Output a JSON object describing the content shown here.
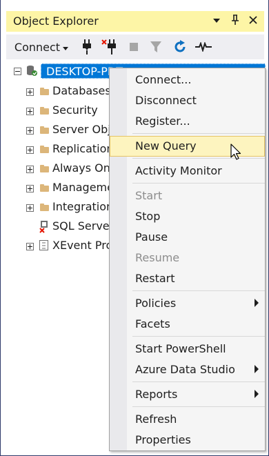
{
  "window": {
    "title": "Object Explorer"
  },
  "title_icons": [
    "chevron-down-icon",
    "pin-icon",
    "close-icon"
  ],
  "toolbar": {
    "connect_label": "Connect"
  },
  "tree": {
    "server_label": "DESKTOP-PDT",
    "nodes": [
      "Databases",
      "Security",
      "Server Obj",
      "Replication",
      "Always On",
      "Manageme",
      "Integration",
      "SQL Server",
      "XEvent Pro"
    ]
  },
  "context_menu": {
    "items": [
      {
        "label": "Connect...",
        "enabled": true
      },
      {
        "label": "Disconnect",
        "enabled": true
      },
      {
        "label": "Register...",
        "enabled": true
      },
      {
        "label": "New Query",
        "enabled": true,
        "highlighted": true
      },
      {
        "label": "Activity Monitor",
        "enabled": true
      },
      {
        "label": "Start",
        "enabled": false
      },
      {
        "label": "Stop",
        "enabled": true
      },
      {
        "label": "Pause",
        "enabled": true
      },
      {
        "label": "Resume",
        "enabled": false
      },
      {
        "label": "Restart",
        "enabled": true
      },
      {
        "label": "Policies",
        "enabled": true,
        "submenu": true
      },
      {
        "label": "Facets",
        "enabled": true
      },
      {
        "label": "Start PowerShell",
        "enabled": true
      },
      {
        "label": "Azure Data Studio",
        "enabled": true,
        "submenu": true
      },
      {
        "label": "Reports",
        "enabled": true,
        "submenu": true
      },
      {
        "label": "Refresh",
        "enabled": true
      },
      {
        "label": "Properties",
        "enabled": true
      }
    ]
  },
  "colors": {
    "title_bar": "#fdf5a6",
    "selection": "#0078d7",
    "menu_highlight": "#fdf4bf"
  }
}
